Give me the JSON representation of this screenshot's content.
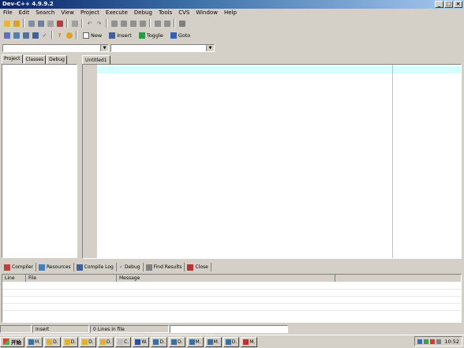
{
  "window": {
    "title": "Dev-C++ 4.9.9.2"
  },
  "menu": [
    "File",
    "Edit",
    "Search",
    "View",
    "Project",
    "Execute",
    "Debug",
    "Tools",
    "CVS",
    "Window",
    "Help"
  ],
  "toolbar2": {
    "new_label": "New",
    "insert_label": "Insert",
    "toggle_label": "Toggle",
    "goto_label": "Goto"
  },
  "left_tabs": [
    "Project",
    "Classes",
    "Debug"
  ],
  "editor": {
    "tab_label": "Untitled1"
  },
  "bottom_tabs": [
    "Compiler",
    "Resources",
    "Compile Log",
    "Debug",
    "Find Results",
    "Close"
  ],
  "results": {
    "columns": [
      "Line",
      "File",
      "Message"
    ]
  },
  "status": {
    "mode": "Insert",
    "lines": "0 Lines in file"
  },
  "taskbar": {
    "start_label": "开始",
    "items": [
      "M.",
      "D.",
      "D.",
      "D.",
      "D.",
      "C.",
      "W.",
      "D.",
      "D.",
      "M.",
      "M.",
      "D.",
      "M."
    ],
    "clock": "10:52"
  },
  "colors": {
    "current_line": "#d4ffff",
    "title_start": "#0a246a",
    "title_end": "#a6caf0"
  }
}
